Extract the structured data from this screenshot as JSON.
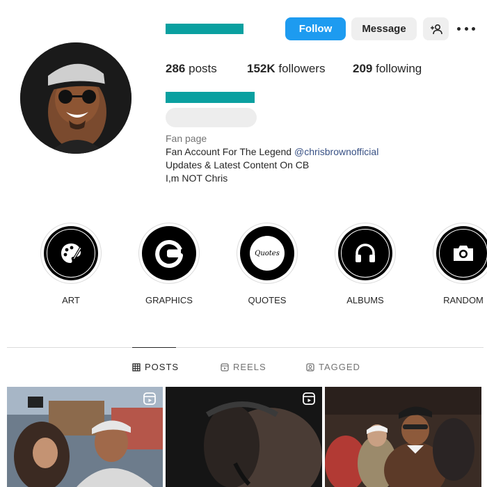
{
  "header": {
    "buttons": {
      "follow": "Follow",
      "message": "Message"
    },
    "icons": {
      "add_user": "person-plus-icon",
      "more": "more-horizontal-icon"
    }
  },
  "stats": {
    "posts": {
      "count": "286",
      "label": "posts"
    },
    "followers": {
      "count": "152K",
      "label": "followers"
    },
    "following": {
      "count": "209",
      "label": "following"
    }
  },
  "bio": {
    "category": "Fan page",
    "line1_prefix": "Fan Account For The Legend ",
    "line1_mention": "@chrisbrownofficial",
    "line2": "Updates & Latest Content On CB",
    "line3": "I,m NOT Chris"
  },
  "highlights": [
    {
      "label": "ART",
      "icon": "palette-icon",
      "inner_text": ""
    },
    {
      "label": "GRAPHICS",
      "icon": "letter-g-icon",
      "inner_text": ""
    },
    {
      "label": "QUOTES",
      "icon": "quotes-text-icon",
      "inner_text": "Quotes"
    },
    {
      "label": "ALBUMS",
      "icon": "headphones-icon",
      "inner_text": ""
    },
    {
      "label": "RANDOM",
      "icon": "camera-icon",
      "inner_text": ""
    }
  ],
  "tabs": [
    {
      "label": "POSTS",
      "icon": "grid-icon",
      "active": true
    },
    {
      "label": "REELS",
      "icon": "reels-icon",
      "active": false
    },
    {
      "label": "TAGGED",
      "icon": "tagged-icon",
      "active": false
    }
  ],
  "colors": {
    "accent": "#1d9bf0",
    "redaction": "#0aa0a0",
    "link": "#385185"
  }
}
